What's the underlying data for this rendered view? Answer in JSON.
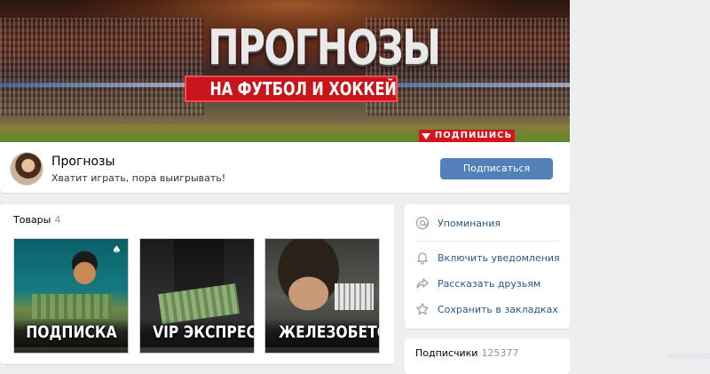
{
  "cover": {
    "title": "ПРОГНОЗЫ",
    "subtitle": "НА ФУТБОЛ И ХОККЕЙ",
    "subscribe_banner": "ПОДПИШИСЬ"
  },
  "group": {
    "name": "Прогнозы",
    "status": "Хватит играть, пора выигрывать!",
    "subscribe_button": "Подписаться"
  },
  "goods": {
    "title": "Товары",
    "count": "4",
    "items": [
      {
        "label": "ПОДПИСКА"
      },
      {
        "label": "VIP ЭКСПРЕСС"
      },
      {
        "label": "ЖЕЛЕЗОБЕТОН"
      }
    ]
  },
  "menu": {
    "mentions": "Упоминания",
    "notifications": "Включить уведомления",
    "share": "Рассказать друзьям",
    "bookmarks": "Сохранить в закладках"
  },
  "followers": {
    "title": "Подписчики",
    "count": "125377"
  },
  "colors": {
    "accent": "#5181b8",
    "link": "#2a5885",
    "banner_red": "#d4161c"
  }
}
